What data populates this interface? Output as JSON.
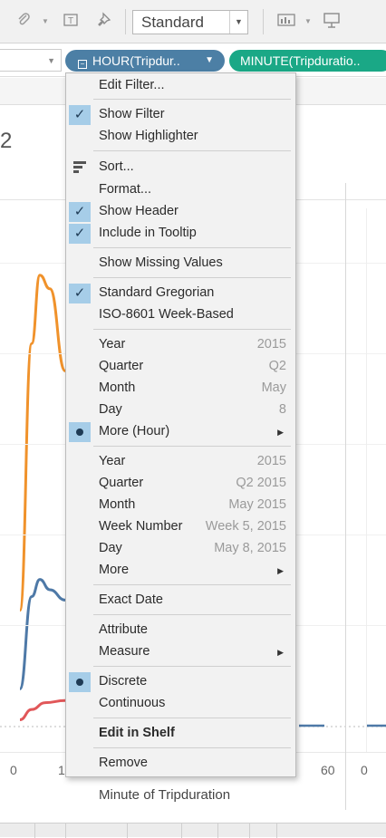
{
  "toolbar": {
    "icons": [
      "paperclip-icon",
      "text-box-icon",
      "pin-icon",
      "bar-chart-icon",
      "presentation-icon"
    ],
    "view_mode": "Standard"
  },
  "shelf": {
    "pill_hour": "HOUR(Tripdur..",
    "pill_minute": "MINUTE(Tripduratio.."
  },
  "partial_header": "2",
  "chart": {
    "x_ticks": [
      "0",
      "1",
      "60",
      "0"
    ],
    "x_title": "Minute of Tripduration",
    "colors": {
      "orange": "#f0922b",
      "blue": "#4e79a7",
      "red": "#e15759"
    }
  },
  "chart_data": {
    "type": "line",
    "x_ticks_visible": [
      "0",
      "1",
      "60",
      "0"
    ],
    "xlabel": "Minute of Tripduration",
    "series": [
      {
        "values": [
          170,
          560,
          660,
          640,
          520
        ]
      },
      {
        "values": [
          55,
          190,
          215,
          200,
          185
        ]
      },
      {
        "values": [
          10,
          25,
          35,
          38
        ]
      }
    ]
  },
  "menu": {
    "edit_filter": "Edit Filter...",
    "show_filter": "Show Filter",
    "show_highlighter": "Show Highlighter",
    "sort": "Sort...",
    "format": "Format...",
    "show_header": "Show Header",
    "include_tooltip": "Include in Tooltip",
    "show_missing": "Show Missing Values",
    "standard_gregorian": "Standard Gregorian",
    "iso_week": "ISO-8601 Week-Based",
    "discrete_parts": [
      {
        "label": "Year",
        "value": "2015"
      },
      {
        "label": "Quarter",
        "value": "Q2"
      },
      {
        "label": "Month",
        "value": "May"
      },
      {
        "label": "Day",
        "value": "8"
      },
      {
        "label": "More (Hour)",
        "value": ""
      }
    ],
    "continuous_parts": [
      {
        "label": "Year",
        "value": "2015"
      },
      {
        "label": "Quarter",
        "value": "Q2 2015"
      },
      {
        "label": "Month",
        "value": "May 2015"
      },
      {
        "label": "Week Number",
        "value": "Week 5, 2015"
      },
      {
        "label": "Day",
        "value": "May 8, 2015"
      },
      {
        "label": "More",
        "value": ""
      }
    ],
    "exact_date": "Exact Date",
    "attribute": "Attribute",
    "measure": "Measure",
    "discrete": "Discrete",
    "continuous": "Continuous",
    "edit_in_shelf": "Edit in Shelf",
    "remove": "Remove"
  }
}
